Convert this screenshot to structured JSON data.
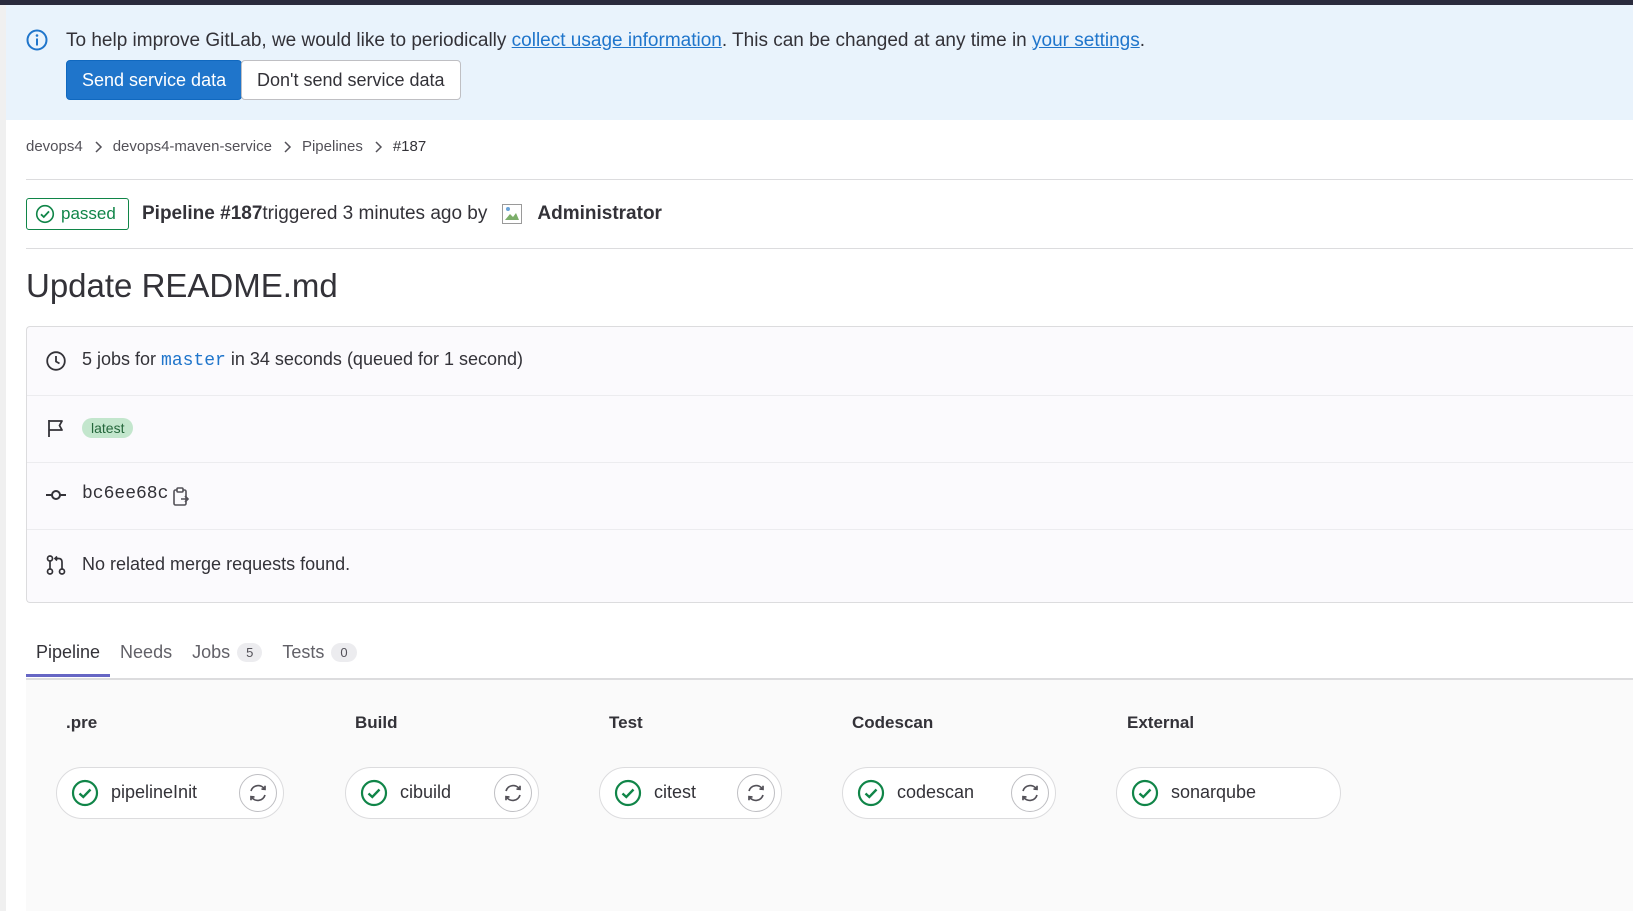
{
  "banner": {
    "text_before": "To help improve GitLab, we would like to periodically ",
    "link1": "collect usage information",
    "text_middle": ". This can be changed at any time in ",
    "link2": "your settings",
    "text_after": ".",
    "send_button": "Send service data",
    "dont_send_button": "Don't send service data"
  },
  "breadcrumb": [
    "devops4",
    "devops4-maven-service",
    "Pipelines",
    "#187"
  ],
  "pipeline": {
    "status": "passed",
    "title": "Pipeline #187",
    "triggered_text": " triggered 3 minutes ago by",
    "author": "Administrator"
  },
  "commit_title": "Update README.md",
  "info": {
    "jobs_prefix": "5 jobs for ",
    "branch": "master",
    "jobs_suffix": " in 34 seconds (queued for 1 second)",
    "tag": "latest",
    "sha": "bc6ee68c",
    "merge_requests": "No related merge requests found."
  },
  "tabs": [
    {
      "label": "Pipeline",
      "count": null
    },
    {
      "label": "Needs",
      "count": null
    },
    {
      "label": "Jobs",
      "count": "5"
    },
    {
      "label": "Tests",
      "count": "0"
    }
  ],
  "stages": [
    {
      "title": ".pre",
      "job": "pipelineInit",
      "retry": true
    },
    {
      "title": "Build",
      "job": "cibuild",
      "retry": true
    },
    {
      "title": "Test",
      "job": "citest",
      "retry": true
    },
    {
      "title": "Codescan",
      "job": "codescan",
      "retry": true
    },
    {
      "title": "External",
      "job": "sonarqube",
      "retry": false
    }
  ],
  "colors": {
    "success": "#108548",
    "link": "#1f75cb",
    "primary_button": "#1f75cb",
    "banner_bg": "#e9f3fc",
    "active_tab_underline": "#6666c4"
  },
  "icons": [
    "info-icon",
    "chevron-right-icon",
    "check-circle-icon",
    "clock-icon",
    "flag-icon",
    "commit-icon",
    "copy-icon",
    "merge-request-icon",
    "retry-icon"
  ]
}
